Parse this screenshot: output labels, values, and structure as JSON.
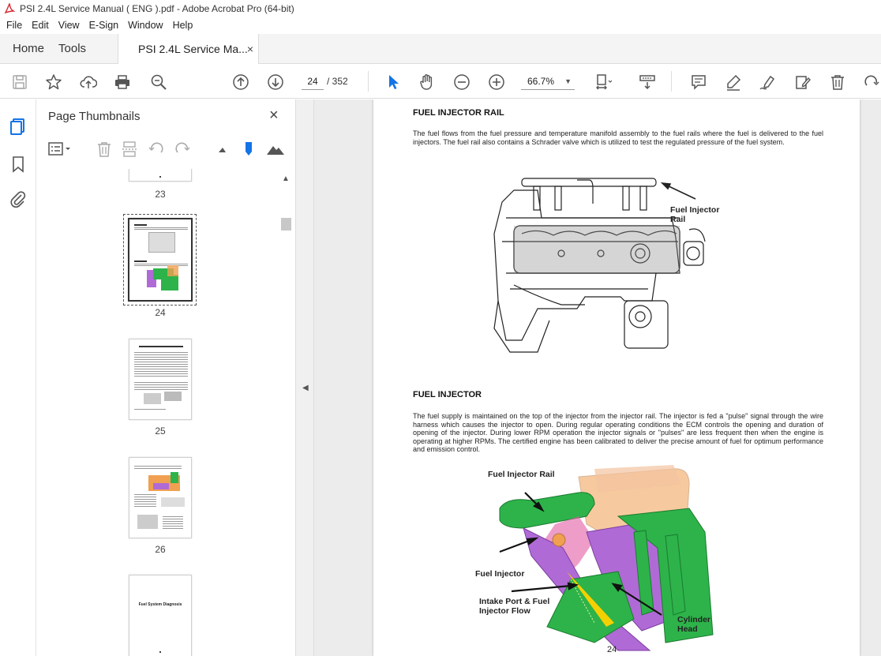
{
  "window": {
    "title": "PSI 2.4L Service Manual ( ENG ).pdf - Adobe Acrobat Pro (64-bit)"
  },
  "menu": [
    "File",
    "Edit",
    "View",
    "E-Sign",
    "Window",
    "Help"
  ],
  "tabs": {
    "home": "Home",
    "tools": "Tools",
    "doc": "PSI 2.4L Service Ma...",
    "close": "×"
  },
  "toolbar": {
    "page_current": "24",
    "page_total": "/ 352",
    "zoom": "66.7%"
  },
  "panel": {
    "title": "Page Thumbnails",
    "close": "×",
    "thumbs": [
      {
        "label": "23"
      },
      {
        "label": "24"
      },
      {
        "label": "25"
      },
      {
        "label": "26"
      },
      {
        "label": ""
      }
    ],
    "thumb5_text": "Fuel System Diagnosis"
  },
  "page": {
    "heading1": "FUEL INJECTOR RAIL",
    "para1": "The fuel flows from the fuel pressure and temperature manifold assembly to the fuel rails where the fuel is delivered to the fuel injectors. The fuel rail also contains a Schrader valve which is utilized to test the regulated pressure of the fuel system.",
    "callout1": "Fuel Injector Rail",
    "heading2": "FUEL INJECTOR",
    "para2": "The fuel supply is maintained on the top of the injector from the injector rail. The injector is fed a \"pulse\" signal through the wire harness which causes the injector to open. During regular operating conditions the ECM controls the opening and duration of opening of the injector. During lower RPM operation the injector signals or \"pulses\" are less frequent then when the engine is operating at higher RPMs. The certified engine has been calibrated to deliver the precise amount of fuel for optimum performance and emission control.",
    "callout2": "Fuel Injector Rail",
    "callout3": "Fuel Injector",
    "callout4": "Intake Port & Fuel Injector Flow",
    "callout5": "Cylinder Head",
    "page_number": "24"
  },
  "colors": {
    "accent": "#1473e6",
    "brand_red": "#d7282f",
    "green_part": "#2db34a",
    "purple_part": "#b06ad6",
    "orange_part": "#f0a050"
  }
}
